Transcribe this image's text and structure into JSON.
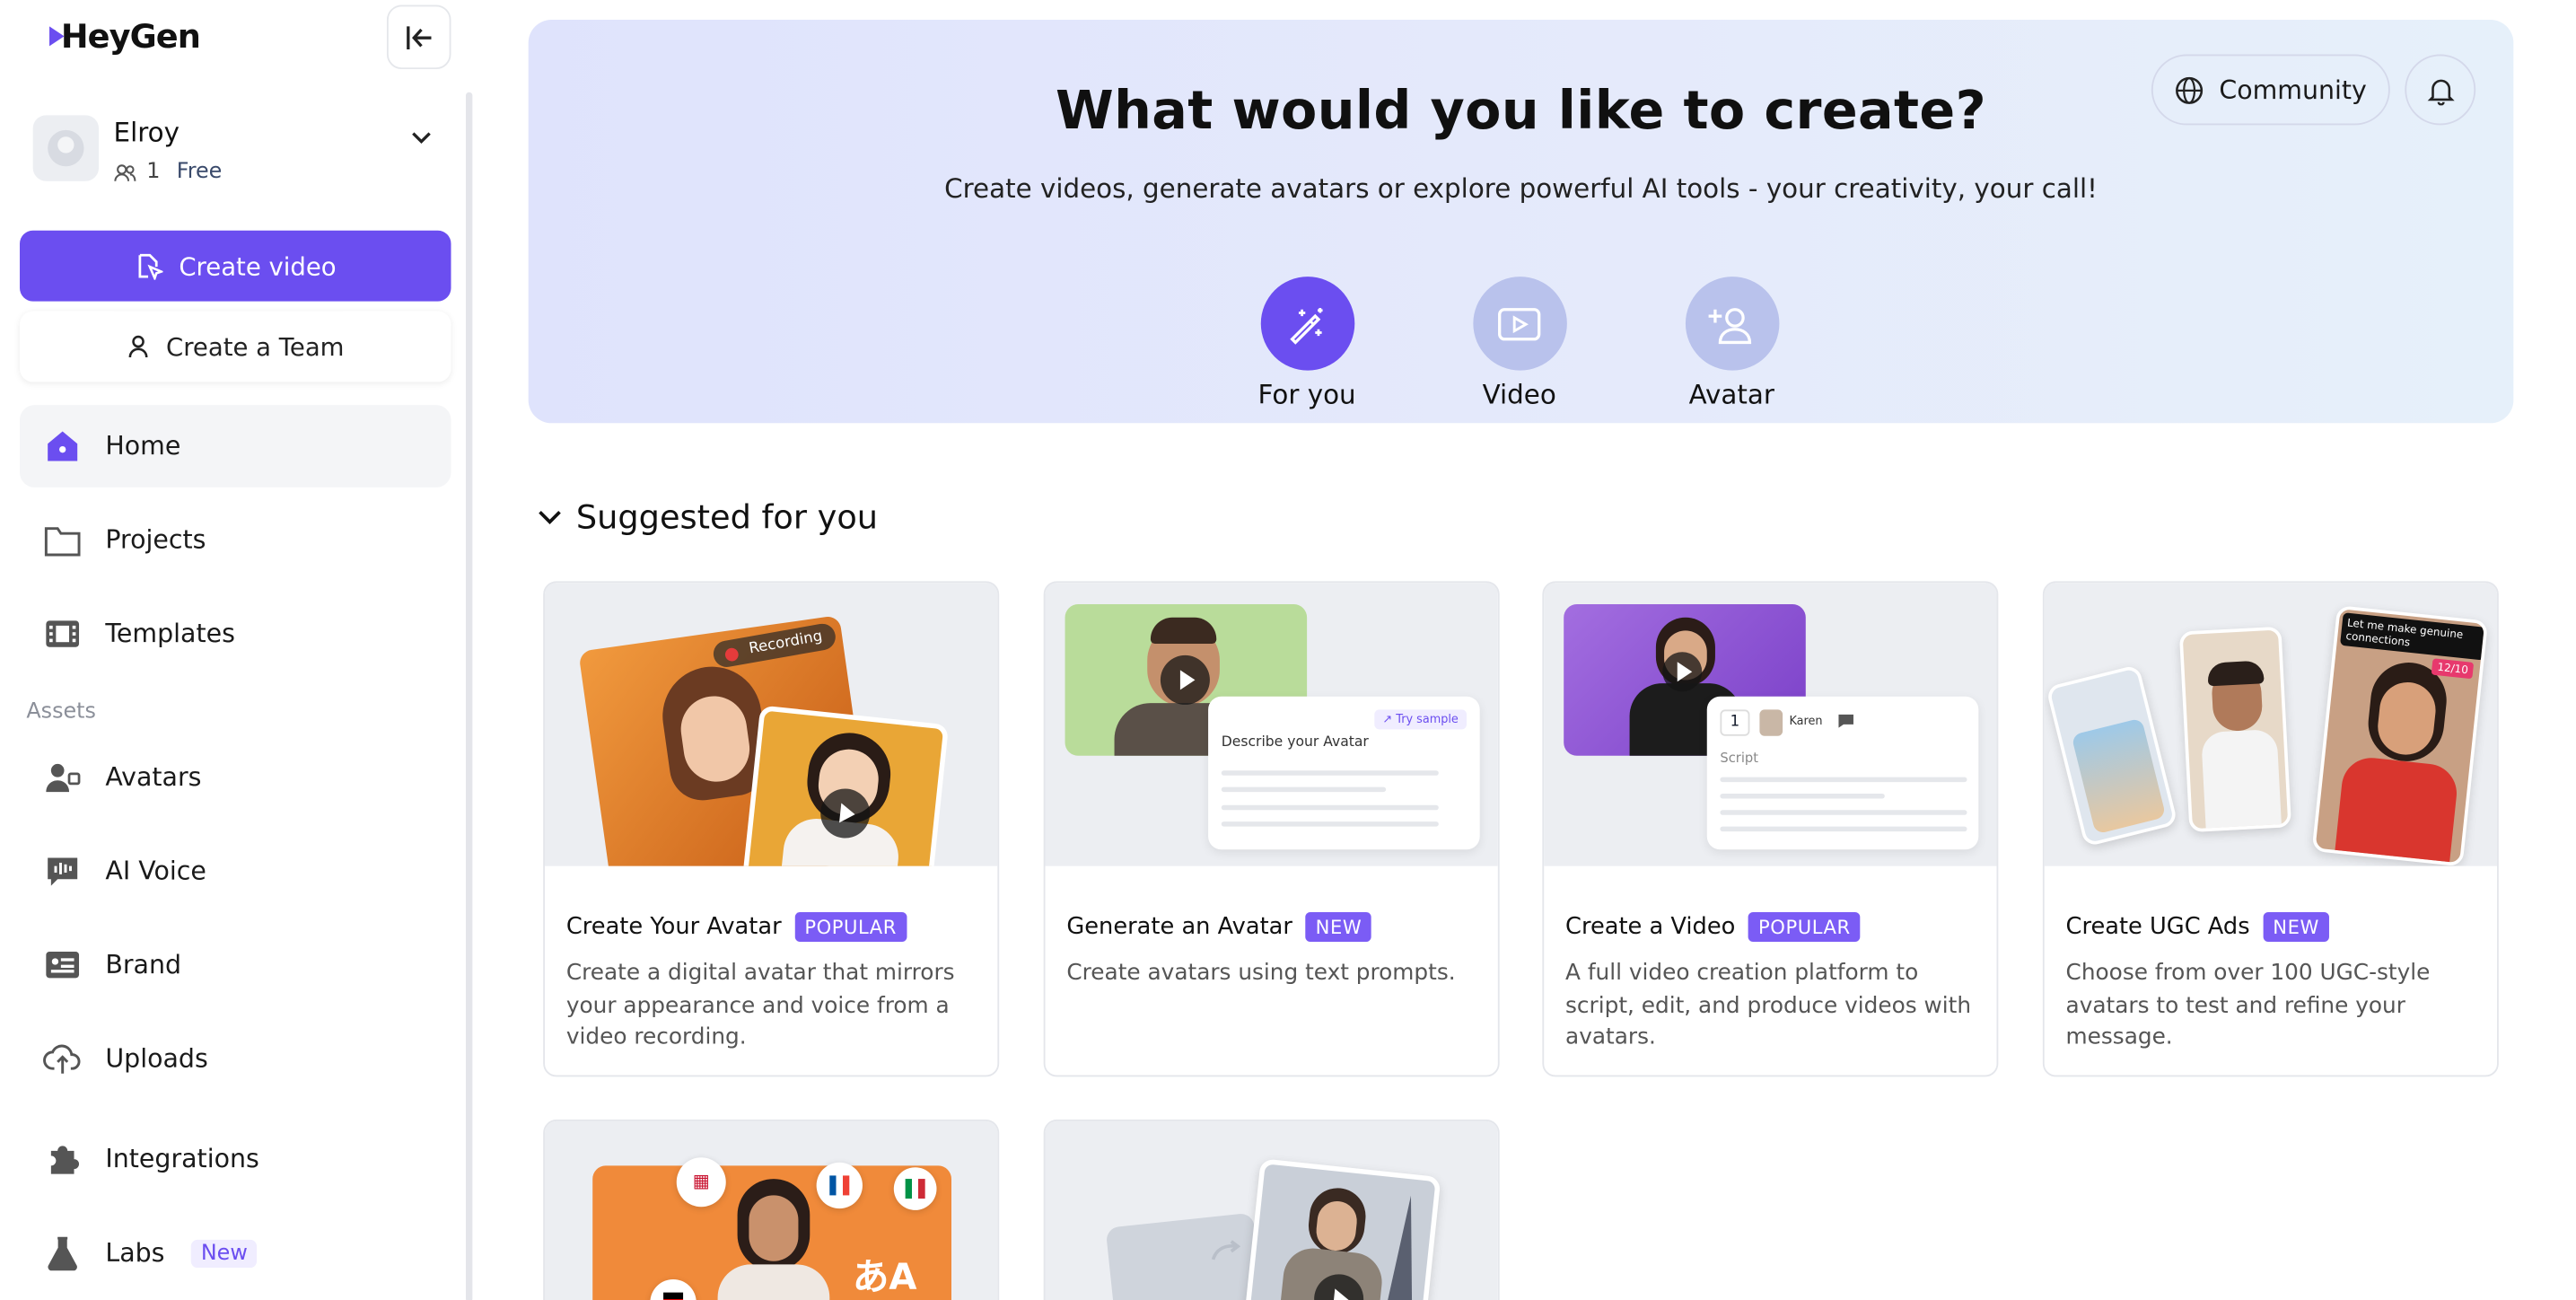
{
  "brand": {
    "logo": "HeyGen",
    "accent": "#6b4ef0"
  },
  "user": {
    "name": "Elroy",
    "member_count": "1",
    "plan": "Free"
  },
  "sidebar": {
    "create_video": "Create video",
    "create_team": "Create a Team",
    "items": [
      {
        "label": "Home",
        "icon": "home-icon"
      },
      {
        "label": "Projects",
        "icon": "folder-icon"
      },
      {
        "label": "Templates",
        "icon": "film-icon"
      }
    ],
    "assets_label": "Assets",
    "assets": [
      {
        "label": "Avatars",
        "icon": "avatar-icon"
      },
      {
        "label": "AI Voice",
        "icon": "voice-icon"
      },
      {
        "label": "Brand",
        "icon": "brand-icon"
      },
      {
        "label": "Uploads",
        "icon": "upload-cloud-icon"
      },
      {
        "label": "Integrations",
        "icon": "puzzle-icon"
      },
      {
        "label": "Labs",
        "icon": "flask-icon",
        "badge": "New"
      }
    ]
  },
  "hero": {
    "title": "What would you like to create?",
    "subtitle": "Create videos, generate avatars or explore powerful AI tools - your creativity, your call!",
    "community": "Community",
    "tabs": [
      {
        "label": "For you",
        "icon": "magic-wand-icon"
      },
      {
        "label": "Video",
        "icon": "video-play-icon"
      },
      {
        "label": "Avatar",
        "icon": "add-person-icon"
      }
    ]
  },
  "suggested": {
    "heading": "Suggested for you",
    "cards": [
      {
        "title": "Create Your Avatar",
        "badge": "POPULAR",
        "desc": "Create a digital avatar that mirrors your appearance and voice from a video recording.",
        "thumb_text": "Recording"
      },
      {
        "title": "Generate an Avatar",
        "badge": "NEW",
        "desc": "Create avatars using text prompts.",
        "thumb_text": "Describe your Avatar",
        "thumb_chip": "Try sample"
      },
      {
        "title": "Create a Video",
        "badge": "POPULAR",
        "desc": "A full video creation platform to script, edit, and produce videos with avatars.",
        "thumb_num": "1",
        "thumb_name": "Karen",
        "thumb_label": "Script"
      },
      {
        "title": "Create UGC Ads",
        "badge": "NEW",
        "desc": "Choose from over 100 UGC-style avatars to test and refine your message.",
        "thumb_text": "Let me make genuine connections",
        "thumb_counter": "12/10"
      }
    ]
  }
}
